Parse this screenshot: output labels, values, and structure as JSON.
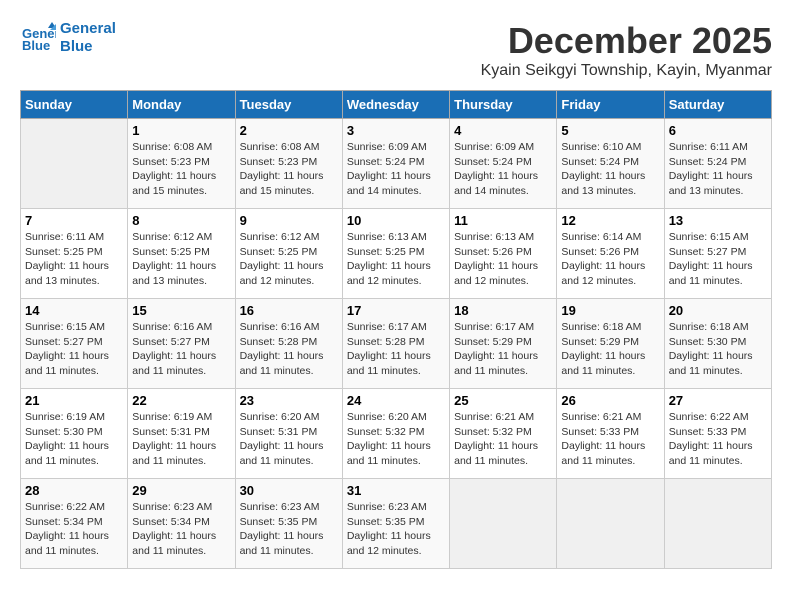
{
  "header": {
    "logo_line1": "General",
    "logo_line2": "Blue",
    "month": "December 2025",
    "location": "Kyain Seikgyi Township, Kayin, Myanmar"
  },
  "weekdays": [
    "Sunday",
    "Monday",
    "Tuesday",
    "Wednesday",
    "Thursday",
    "Friday",
    "Saturday"
  ],
  "weeks": [
    [
      {
        "day": "",
        "sunrise": "",
        "sunset": "",
        "daylight": ""
      },
      {
        "day": "1",
        "sunrise": "6:08 AM",
        "sunset": "5:23 PM",
        "daylight": "11 hours and 15 minutes."
      },
      {
        "day": "2",
        "sunrise": "6:08 AM",
        "sunset": "5:23 PM",
        "daylight": "11 hours and 15 minutes."
      },
      {
        "day": "3",
        "sunrise": "6:09 AM",
        "sunset": "5:24 PM",
        "daylight": "11 hours and 14 minutes."
      },
      {
        "day": "4",
        "sunrise": "6:09 AM",
        "sunset": "5:24 PM",
        "daylight": "11 hours and 14 minutes."
      },
      {
        "day": "5",
        "sunrise": "6:10 AM",
        "sunset": "5:24 PM",
        "daylight": "11 hours and 13 minutes."
      },
      {
        "day": "6",
        "sunrise": "6:11 AM",
        "sunset": "5:24 PM",
        "daylight": "11 hours and 13 minutes."
      }
    ],
    [
      {
        "day": "7",
        "sunrise": "6:11 AM",
        "sunset": "5:25 PM",
        "daylight": "11 hours and 13 minutes."
      },
      {
        "day": "8",
        "sunrise": "6:12 AM",
        "sunset": "5:25 PM",
        "daylight": "11 hours and 13 minutes."
      },
      {
        "day": "9",
        "sunrise": "6:12 AM",
        "sunset": "5:25 PM",
        "daylight": "11 hours and 12 minutes."
      },
      {
        "day": "10",
        "sunrise": "6:13 AM",
        "sunset": "5:25 PM",
        "daylight": "11 hours and 12 minutes."
      },
      {
        "day": "11",
        "sunrise": "6:13 AM",
        "sunset": "5:26 PM",
        "daylight": "11 hours and 12 minutes."
      },
      {
        "day": "12",
        "sunrise": "6:14 AM",
        "sunset": "5:26 PM",
        "daylight": "11 hours and 12 minutes."
      },
      {
        "day": "13",
        "sunrise": "6:15 AM",
        "sunset": "5:27 PM",
        "daylight": "11 hours and 11 minutes."
      }
    ],
    [
      {
        "day": "14",
        "sunrise": "6:15 AM",
        "sunset": "5:27 PM",
        "daylight": "11 hours and 11 minutes."
      },
      {
        "day": "15",
        "sunrise": "6:16 AM",
        "sunset": "5:27 PM",
        "daylight": "11 hours and 11 minutes."
      },
      {
        "day": "16",
        "sunrise": "6:16 AM",
        "sunset": "5:28 PM",
        "daylight": "11 hours and 11 minutes."
      },
      {
        "day": "17",
        "sunrise": "6:17 AM",
        "sunset": "5:28 PM",
        "daylight": "11 hours and 11 minutes."
      },
      {
        "day": "18",
        "sunrise": "6:17 AM",
        "sunset": "5:29 PM",
        "daylight": "11 hours and 11 minutes."
      },
      {
        "day": "19",
        "sunrise": "6:18 AM",
        "sunset": "5:29 PM",
        "daylight": "11 hours and 11 minutes."
      },
      {
        "day": "20",
        "sunrise": "6:18 AM",
        "sunset": "5:30 PM",
        "daylight": "11 hours and 11 minutes."
      }
    ],
    [
      {
        "day": "21",
        "sunrise": "6:19 AM",
        "sunset": "5:30 PM",
        "daylight": "11 hours and 11 minutes."
      },
      {
        "day": "22",
        "sunrise": "6:19 AM",
        "sunset": "5:31 PM",
        "daylight": "11 hours and 11 minutes."
      },
      {
        "day": "23",
        "sunrise": "6:20 AM",
        "sunset": "5:31 PM",
        "daylight": "11 hours and 11 minutes."
      },
      {
        "day": "24",
        "sunrise": "6:20 AM",
        "sunset": "5:32 PM",
        "daylight": "11 hours and 11 minutes."
      },
      {
        "day": "25",
        "sunrise": "6:21 AM",
        "sunset": "5:32 PM",
        "daylight": "11 hours and 11 minutes."
      },
      {
        "day": "26",
        "sunrise": "6:21 AM",
        "sunset": "5:33 PM",
        "daylight": "11 hours and 11 minutes."
      },
      {
        "day": "27",
        "sunrise": "6:22 AM",
        "sunset": "5:33 PM",
        "daylight": "11 hours and 11 minutes."
      }
    ],
    [
      {
        "day": "28",
        "sunrise": "6:22 AM",
        "sunset": "5:34 PM",
        "daylight": "11 hours and 11 minutes."
      },
      {
        "day": "29",
        "sunrise": "6:23 AM",
        "sunset": "5:34 PM",
        "daylight": "11 hours and 11 minutes."
      },
      {
        "day": "30",
        "sunrise": "6:23 AM",
        "sunset": "5:35 PM",
        "daylight": "11 hours and 11 minutes."
      },
      {
        "day": "31",
        "sunrise": "6:23 AM",
        "sunset": "5:35 PM",
        "daylight": "11 hours and 12 minutes."
      },
      {
        "day": "",
        "sunrise": "",
        "sunset": "",
        "daylight": ""
      },
      {
        "day": "",
        "sunrise": "",
        "sunset": "",
        "daylight": ""
      },
      {
        "day": "",
        "sunrise": "",
        "sunset": "",
        "daylight": ""
      }
    ]
  ]
}
